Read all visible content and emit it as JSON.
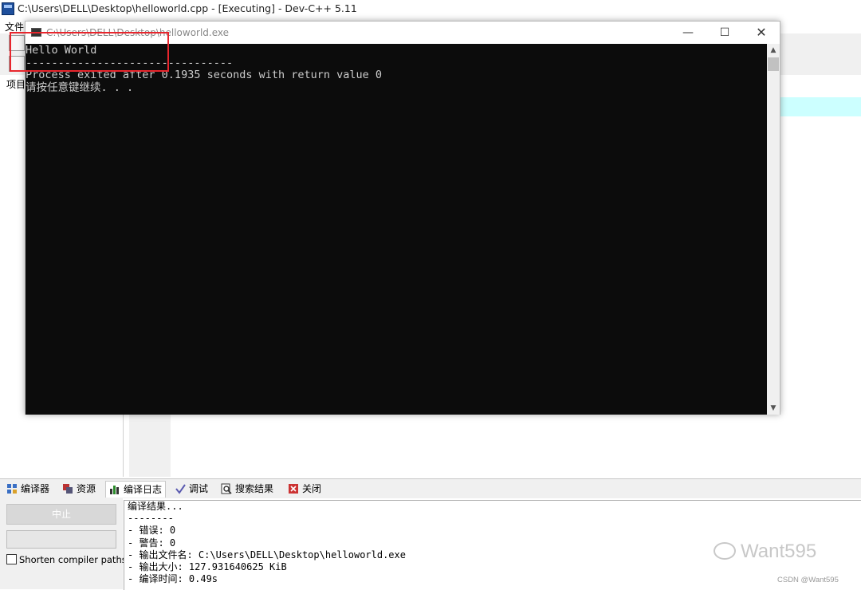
{
  "main_window": {
    "title": "C:\\Users\\DELL\\Desktop\\helloworld.cpp - [Executing] - Dev-C++ 5.11",
    "menu_file": "文件",
    "left_panel_title": "项目"
  },
  "console": {
    "title": "C:\\Users\\DELL\\Desktop\\helloworld.exe",
    "lines": [
      "Hello World",
      "--------------------------------",
      "Process exited after 0.1935 seconds with return value 0",
      "请按任意键继续. . ."
    ],
    "min_glyph": "—",
    "max_glyph": "☐",
    "close_glyph": "✕"
  },
  "bottom": {
    "tabs": [
      {
        "label": "编译器",
        "icon": "compiler-icon"
      },
      {
        "label": "资源",
        "icon": "resources-icon"
      },
      {
        "label": "编译日志",
        "icon": "bar-chart-icon"
      },
      {
        "label": "调试",
        "icon": "checkmark-icon"
      },
      {
        "label": "搜索结果",
        "icon": "search-icon"
      },
      {
        "label": "关闭",
        "icon": "close-icon"
      }
    ],
    "stop_label": "中止",
    "shorten_label": "Shorten compiler paths",
    "log_lines": [
      "编译结果...",
      "--------",
      "- 错误: 0",
      "- 警告: 0",
      "- 输出文件名: C:\\Users\\DELL\\Desktop\\helloworld.exe",
      "- 输出大小: 127.931640625 KiB",
      "- 编译时间: 0.49s"
    ]
  },
  "watermark": {
    "text": "Want595",
    "csdn": "CSDN @Want595"
  },
  "colors": {
    "console_bg": "#0c0c0c",
    "console_text": "#cccccc",
    "highlight_box": "#e8262d",
    "editor_current_line": "#ccffff"
  }
}
